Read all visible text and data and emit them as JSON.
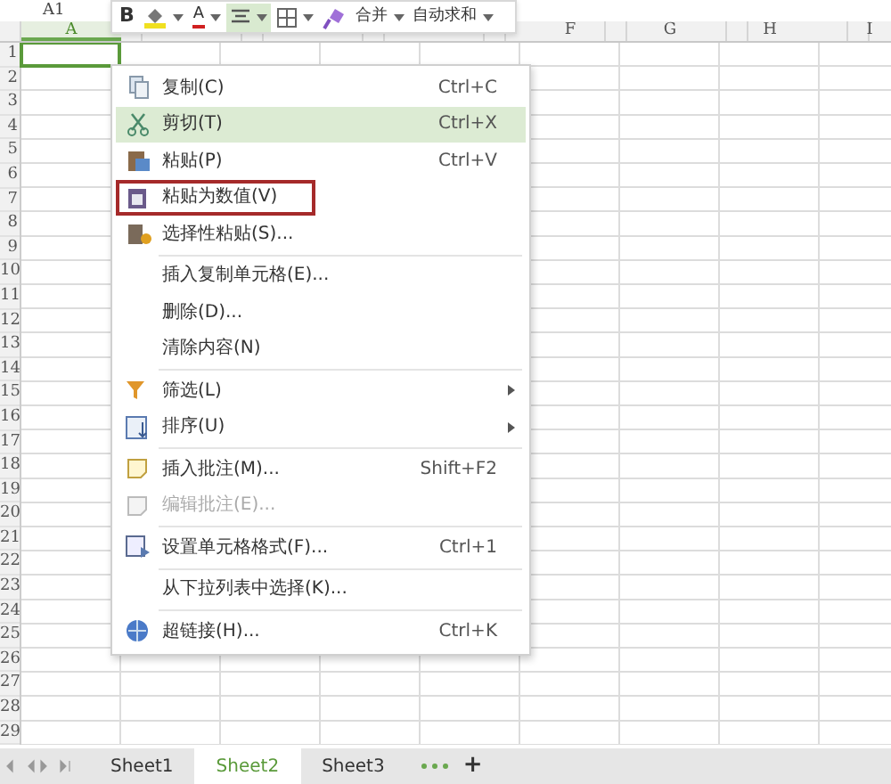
{
  "name_box": "A1",
  "toolbar": [
    {
      "kind": "text",
      "label": "B",
      "dropdown": false,
      "selected": false
    },
    {
      "kind": "icon",
      "dropdown": true,
      "selected": false
    },
    {
      "kind": "text",
      "label": "A",
      "dropdown": true,
      "selected": false
    },
    {
      "kind": "icon",
      "dropdown": true,
      "selected": true
    },
    {
      "kind": "icon",
      "dropdown": true,
      "selected": false
    },
    {
      "kind": "icon",
      "dropdown": false,
      "selected": false
    },
    {
      "kind": "text",
      "label": "合并",
      "dropdown": true,
      "selected": false
    },
    {
      "kind": "text",
      "label": "自动求和",
      "dropdown": true,
      "selected": false
    }
  ],
  "columns": [
    {
      "label": "A",
      "selected": true
    },
    {
      "selected": false
    },
    {
      "selected": false
    },
    {
      "selected": false
    },
    {
      "selected": false
    },
    {
      "label": "F",
      "selected": false
    },
    {
      "label": "G",
      "selected": false
    },
    {
      "label": "H",
      "selected": false
    },
    {
      "label": "I",
      "selected": false
    }
  ],
  "rows": [
    "1",
    "2",
    "3",
    "4",
    "5",
    "6",
    "7",
    "8",
    "9",
    "10",
    "11",
    "12",
    "13",
    "14",
    "15",
    "16",
    "17",
    "18",
    "19",
    "20",
    "21",
    "22",
    "23",
    "24",
    "25",
    "26",
    "27",
    "28",
    "29"
  ],
  "context_menu": [
    {
      "label": "复制(C)",
      "shortcut": "Ctrl+C",
      "selected": false,
      "disabled": false,
      "outlined": false,
      "submenu": false,
      "separator_after": false
    },
    {
      "label": "剪切(T)",
      "shortcut": "Ctrl+X",
      "selected": true,
      "disabled": false,
      "outlined": false,
      "submenu": false,
      "separator_after": false
    },
    {
      "label": "粘贴(P)",
      "shortcut": "Ctrl+V",
      "selected": false,
      "disabled": false,
      "outlined": false,
      "submenu": false,
      "separator_after": false
    },
    {
      "label": "粘贴为数值(V)",
      "selected": false,
      "disabled": false,
      "outlined": true,
      "submenu": false,
      "separator_after": false
    },
    {
      "label": "选择性粘贴(S)...",
      "selected": false,
      "disabled": false,
      "outlined": false,
      "submenu": false,
      "separator_after": true
    },
    {
      "label": "插入复制单元格(E)...",
      "selected": false,
      "disabled": false,
      "outlined": false,
      "submenu": false,
      "separator_after": false
    },
    {
      "label": "删除(D)...",
      "selected": false,
      "disabled": false,
      "outlined": false,
      "submenu": false,
      "separator_after": false
    },
    {
      "label": "清除内容(N)",
      "selected": false,
      "disabled": false,
      "outlined": false,
      "submenu": false,
      "separator_after": true
    },
    {
      "label": "筛选(L)",
      "selected": false,
      "disabled": false,
      "outlined": false,
      "submenu": true,
      "separator_after": false
    },
    {
      "label": "排序(U)",
      "selected": false,
      "disabled": false,
      "outlined": false,
      "submenu": true,
      "separator_after": true
    },
    {
      "label": "插入批注(M)...",
      "shortcut": "Shift+F2",
      "selected": false,
      "disabled": false,
      "outlined": false,
      "submenu": false,
      "separator_after": false
    },
    {
      "label": "编辑批注(E)...",
      "selected": false,
      "disabled": true,
      "outlined": false,
      "submenu": false,
      "separator_after": true
    },
    {
      "label": "设置单元格格式(F)...",
      "shortcut": "Ctrl+1",
      "selected": false,
      "disabled": false,
      "outlined": false,
      "submenu": false,
      "separator_after": true
    },
    {
      "label": "从下拉列表中选择(K)...",
      "selected": false,
      "disabled": false,
      "outlined": false,
      "submenu": false,
      "separator_after": true
    },
    {
      "label": "超链接(H)...",
      "shortcut": "Ctrl+K",
      "selected": false,
      "disabled": false,
      "outlined": false,
      "submenu": false,
      "separator_after": false
    }
  ],
  "sheet_tabs": [
    {
      "label": "Sheet1",
      "selected": false
    },
    {
      "label": "Sheet2",
      "selected": true
    },
    {
      "label": "Sheet3",
      "selected": false
    }
  ],
  "add_sheet": "+"
}
